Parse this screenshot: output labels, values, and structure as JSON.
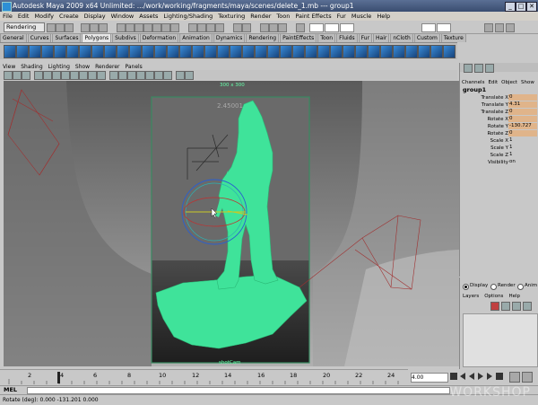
{
  "window": {
    "title": "Autodesk Maya 2009 x64 Unlimited: .../work/working/fragments/maya/scenes/delete_1.mb  ---  group1",
    "controls": [
      "_",
      "□",
      "✕"
    ]
  },
  "menubar": [
    "File",
    "Edit",
    "Modify",
    "Create",
    "Display",
    "Window",
    "Assets",
    "Lighting/Shading",
    "Texturing",
    "Render",
    "Toon",
    "Paint Effects",
    "Fur",
    "Muscle",
    "Help"
  ],
  "status_line": {
    "mode": "Rendering"
  },
  "shelf_tabs": [
    "General",
    "Curves",
    "Surfaces",
    "Polygons",
    "Subdivs",
    "Deformation",
    "Animation",
    "Dynamics",
    "Rendering",
    "PaintEffects",
    "Toon",
    "Fluids",
    "Fur",
    "Hair",
    "nCloth",
    "Custom",
    "Texture"
  ],
  "active_shelf_tab": "Polygons",
  "panel_menu": [
    "View",
    "Shading",
    "Lighting",
    "Show",
    "Renderer",
    "Panels"
  ],
  "viewport": {
    "resolution_gate_label": "300 x 300",
    "camera_label": "shotCam",
    "ghost_label": "2.45001",
    "colors": {
      "background": "#7e7e7e",
      "model": "#3fe39a",
      "gate": "#3a8a62"
    }
  },
  "channel_box": {
    "menu": [
      "Channels",
      "Edit",
      "Object",
      "Show"
    ],
    "object_name": "group1",
    "attributes": [
      {
        "name": "Translate X",
        "value": "0"
      },
      {
        "name": "Translate Y",
        "value": "4.31"
      },
      {
        "name": "Translate Z",
        "value": "0"
      },
      {
        "name": "Rotate X",
        "value": "0"
      },
      {
        "name": "Rotate Y",
        "value": "-130.727"
      },
      {
        "name": "Rotate Z",
        "value": "0"
      },
      {
        "name": "Scale X",
        "value": "1"
      },
      {
        "name": "Scale Y",
        "value": "1"
      },
      {
        "name": "Scale Z",
        "value": "1"
      },
      {
        "name": "Visibility",
        "value": "on"
      }
    ]
  },
  "layer_editor": {
    "radio_options": [
      "Display",
      "Render",
      "Anim"
    ],
    "selected_option": "Display",
    "menu": [
      "Layers",
      "Options",
      "Help"
    ]
  },
  "timeline": {
    "ticks": [
      "2",
      "4",
      "6",
      "8",
      "10",
      "12",
      "14",
      "16",
      "18",
      "20",
      "22",
      "24"
    ],
    "current_time": "4.00"
  },
  "command_line": {
    "label": "MEL"
  },
  "help_line": {
    "text": "Rotate (deg):  0.000     -131.201    0.000"
  },
  "watermark": "WORKSHOP"
}
